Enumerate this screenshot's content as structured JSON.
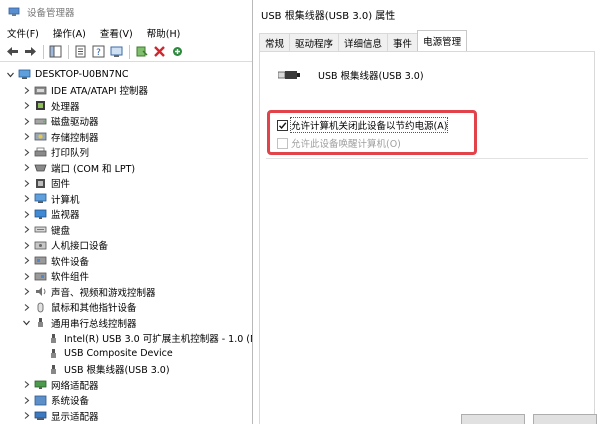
{
  "device_manager": {
    "title": "设备管理器",
    "menu": [
      "文件(F)",
      "操作(A)",
      "查看(V)",
      "帮助(H)"
    ],
    "toolbar_icons": [
      "back-arrow-icon",
      "forward-arrow-icon",
      "show-hide-tree-icon",
      "properties-icon",
      "help-icon",
      "update-driver-icon",
      "scan-hardware-icon",
      "add-legacy-icon",
      "uninstall-icon"
    ],
    "tree": {
      "root": "DESKTOP-U0BN7NC",
      "categories": [
        {
          "label": "IDE ATA/ATAPI 控制器",
          "icon": "ide-icon"
        },
        {
          "label": "处理器",
          "icon": "processor-icon"
        },
        {
          "label": "磁盘驱动器",
          "icon": "disk-icon"
        },
        {
          "label": "存储控制器",
          "icon": "storage-icon"
        },
        {
          "label": "打印队列",
          "icon": "printer-icon"
        },
        {
          "label": "端口 (COM 和 LPT)",
          "icon": "port-icon"
        },
        {
          "label": "固件",
          "icon": "firmware-icon"
        },
        {
          "label": "计算机",
          "icon": "computer-icon"
        },
        {
          "label": "监视器",
          "icon": "monitor-icon"
        },
        {
          "label": "键盘",
          "icon": "keyboard-icon"
        },
        {
          "label": "人机接口设备",
          "icon": "hid-icon"
        },
        {
          "label": "软件设备",
          "icon": "software-device-icon"
        },
        {
          "label": "软件组件",
          "icon": "software-component-icon"
        },
        {
          "label": "声音、视频和游戏控制器",
          "icon": "sound-icon"
        },
        {
          "label": "鼠标和其他指针设备",
          "icon": "mouse-icon"
        },
        {
          "label": "通用串行总线控制器",
          "icon": "usb-icon"
        }
      ],
      "usb_children": [
        "Intel(R) USB 3.0 可扩展主机控制器 - 1.0 (Mi",
        "USB Composite Device",
        "USB 根集线器(USB 3.0)"
      ],
      "after": [
        {
          "label": "网络适配器",
          "icon": "network-icon"
        },
        {
          "label": "系统设备",
          "icon": "system-icon"
        },
        {
          "label": "显示适配器",
          "icon": "display-icon"
        }
      ]
    }
  },
  "dialog": {
    "title": "USB 根集线器(USB 3.0) 属性",
    "tabs": [
      "常规",
      "驱动程序",
      "详细信息",
      "事件",
      "电源管理"
    ],
    "active_tab": "电源管理",
    "device_name": "USB 根集线器(USB 3.0)",
    "options": [
      {
        "label": "允许计算机关闭此设备以节约电源(A)",
        "checked": true,
        "enabled": true
      },
      {
        "label": "允许此设备唤醒计算机(O)",
        "checked": false,
        "enabled": false
      }
    ],
    "highlight_color": "#e2424a"
  }
}
